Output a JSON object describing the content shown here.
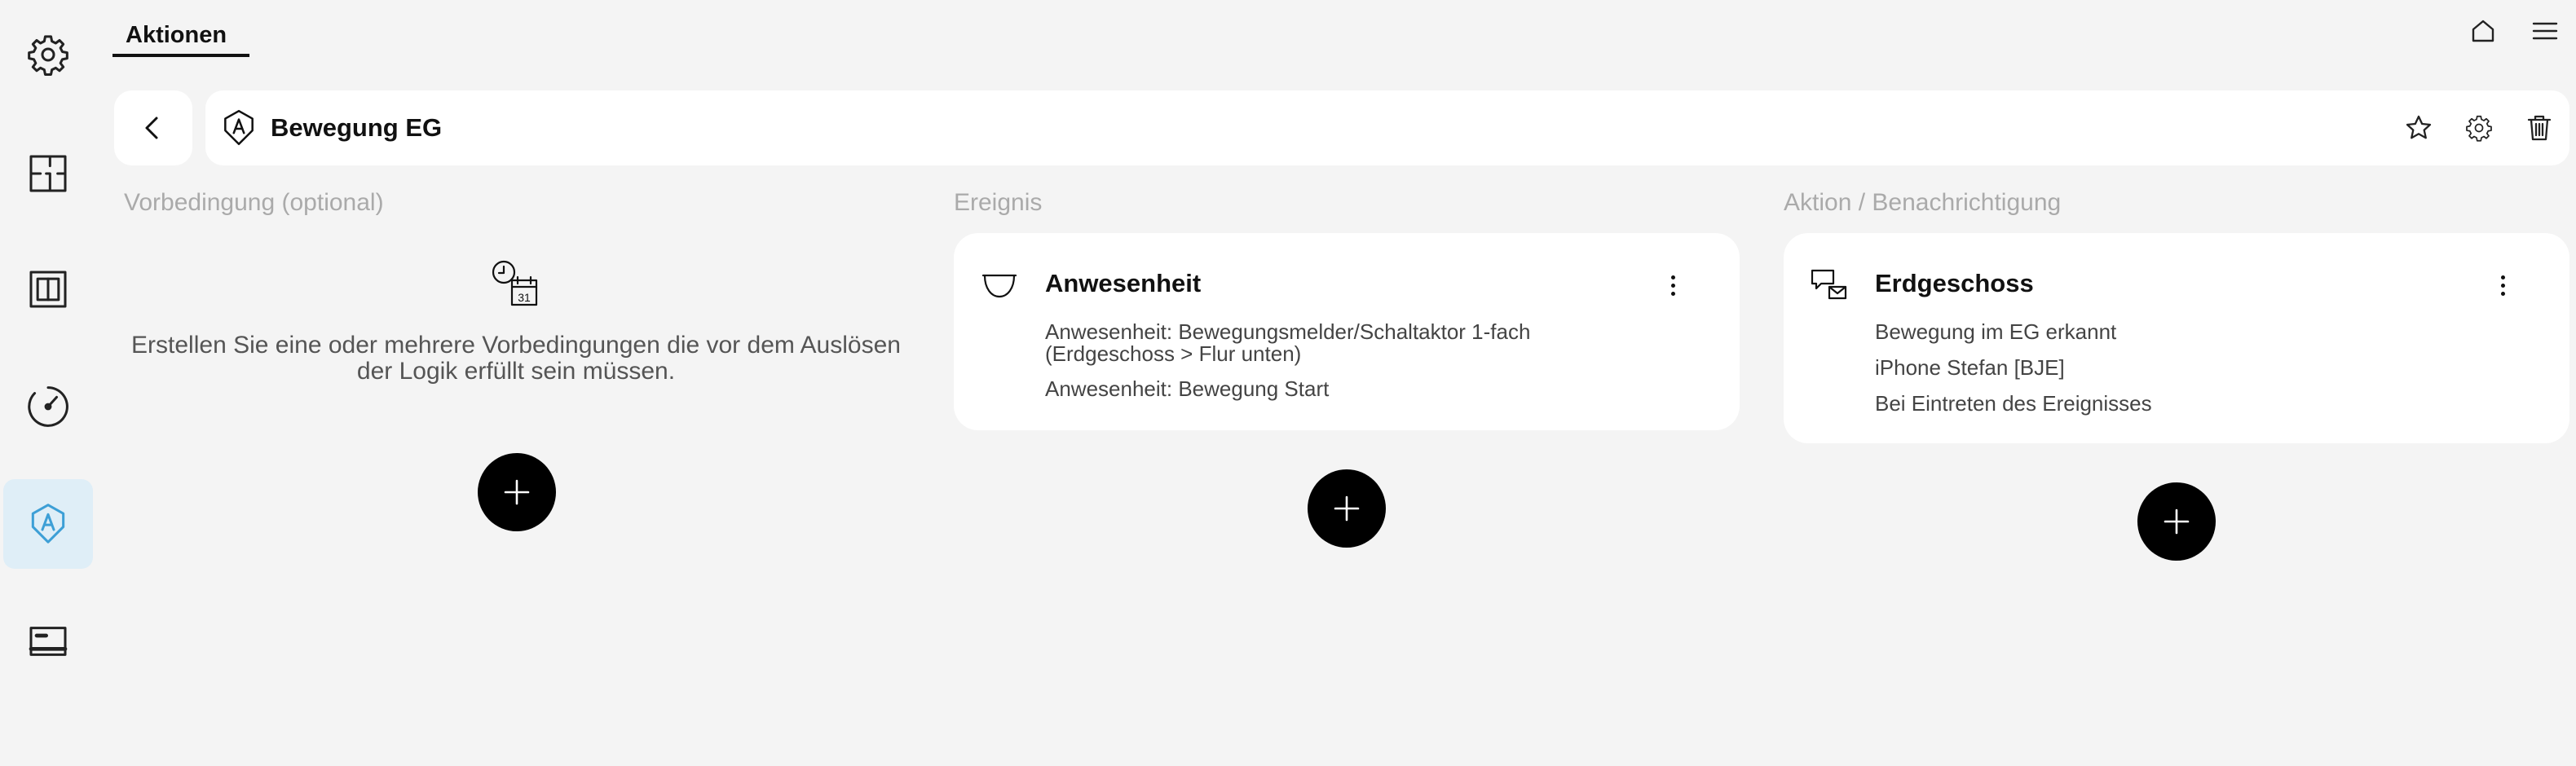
{
  "app": {
    "tab_label": "Aktionen"
  },
  "sidebar": {
    "items": [
      {
        "icon": "gear-icon",
        "active": false
      },
      {
        "icon": "floorplan-icon",
        "active": false
      },
      {
        "icon": "panel-icon",
        "active": false
      },
      {
        "icon": "gauge-icon",
        "active": false
      },
      {
        "icon": "action-icon",
        "active": true
      },
      {
        "icon": "display-icon",
        "active": false
      }
    ]
  },
  "top_right": {
    "icons": [
      "home-icon",
      "menu-icon"
    ]
  },
  "header": {
    "title": "Bewegung EG",
    "title_icon": "action-icon",
    "actions": [
      "star-icon",
      "gear-icon",
      "trash-icon"
    ]
  },
  "columns": {
    "precondition": {
      "label": "Vorbedingung (optional)",
      "empty_icon": "clock-calendar-icon",
      "empty_text": "Erstellen Sie eine oder mehrere Vorbedingungen die vor dem Auslösen der Logik erfüllt sein müssen.",
      "calendar_day": "31"
    },
    "event": {
      "label": "Ereignis",
      "card": {
        "icon": "presence-icon",
        "title": "Anwesenheit",
        "lines": [
          "Anwesenheit: Bewegungsmelder/Schaltaktor 1-fach",
          "(Erdgeschoss > Flur unten)",
          "Anwesenheit: Bewegung Start"
        ]
      }
    },
    "action": {
      "label": "Aktion / Benachrichtigung",
      "card": {
        "icon": "notification-icon",
        "title": "Erdgeschoss",
        "lines": [
          "Bewegung im EG erkannt",
          "iPhone Stefan [BJE]",
          "Bei Eintreten des Ereignisses"
        ]
      }
    }
  },
  "colors": {
    "background": "#f4f4f4",
    "card": "#ffffff",
    "active_nav_bg": "#dfeef7",
    "active_nav_icon": "#3d9fd6",
    "column_label": "#aaaaaa",
    "add_button": "#000000"
  }
}
